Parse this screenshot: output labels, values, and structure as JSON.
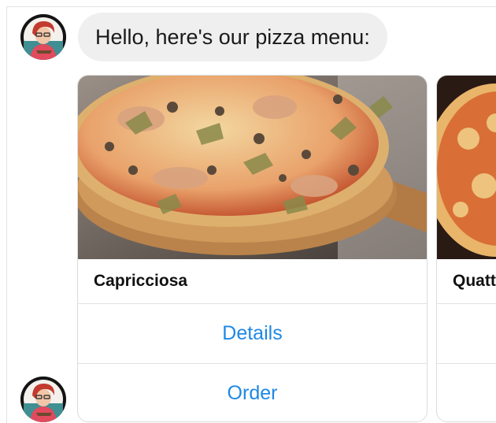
{
  "colors": {
    "bubble_bg": "#efefef",
    "button_text": "#1e88e5",
    "divider": "#e1e1e1"
  },
  "message": {
    "text": "Hello, here's our pizza menu:"
  },
  "avatar": {
    "icon": "bot-avatar-icon"
  },
  "cards": [
    {
      "title": "Capricciosa",
      "image": "capricciosa-pizza-photo",
      "buttons": [
        "Details",
        "Order"
      ]
    },
    {
      "title": "Quatt",
      "image": "second-pizza-photo",
      "buttons": [
        "",
        ""
      ]
    }
  ]
}
